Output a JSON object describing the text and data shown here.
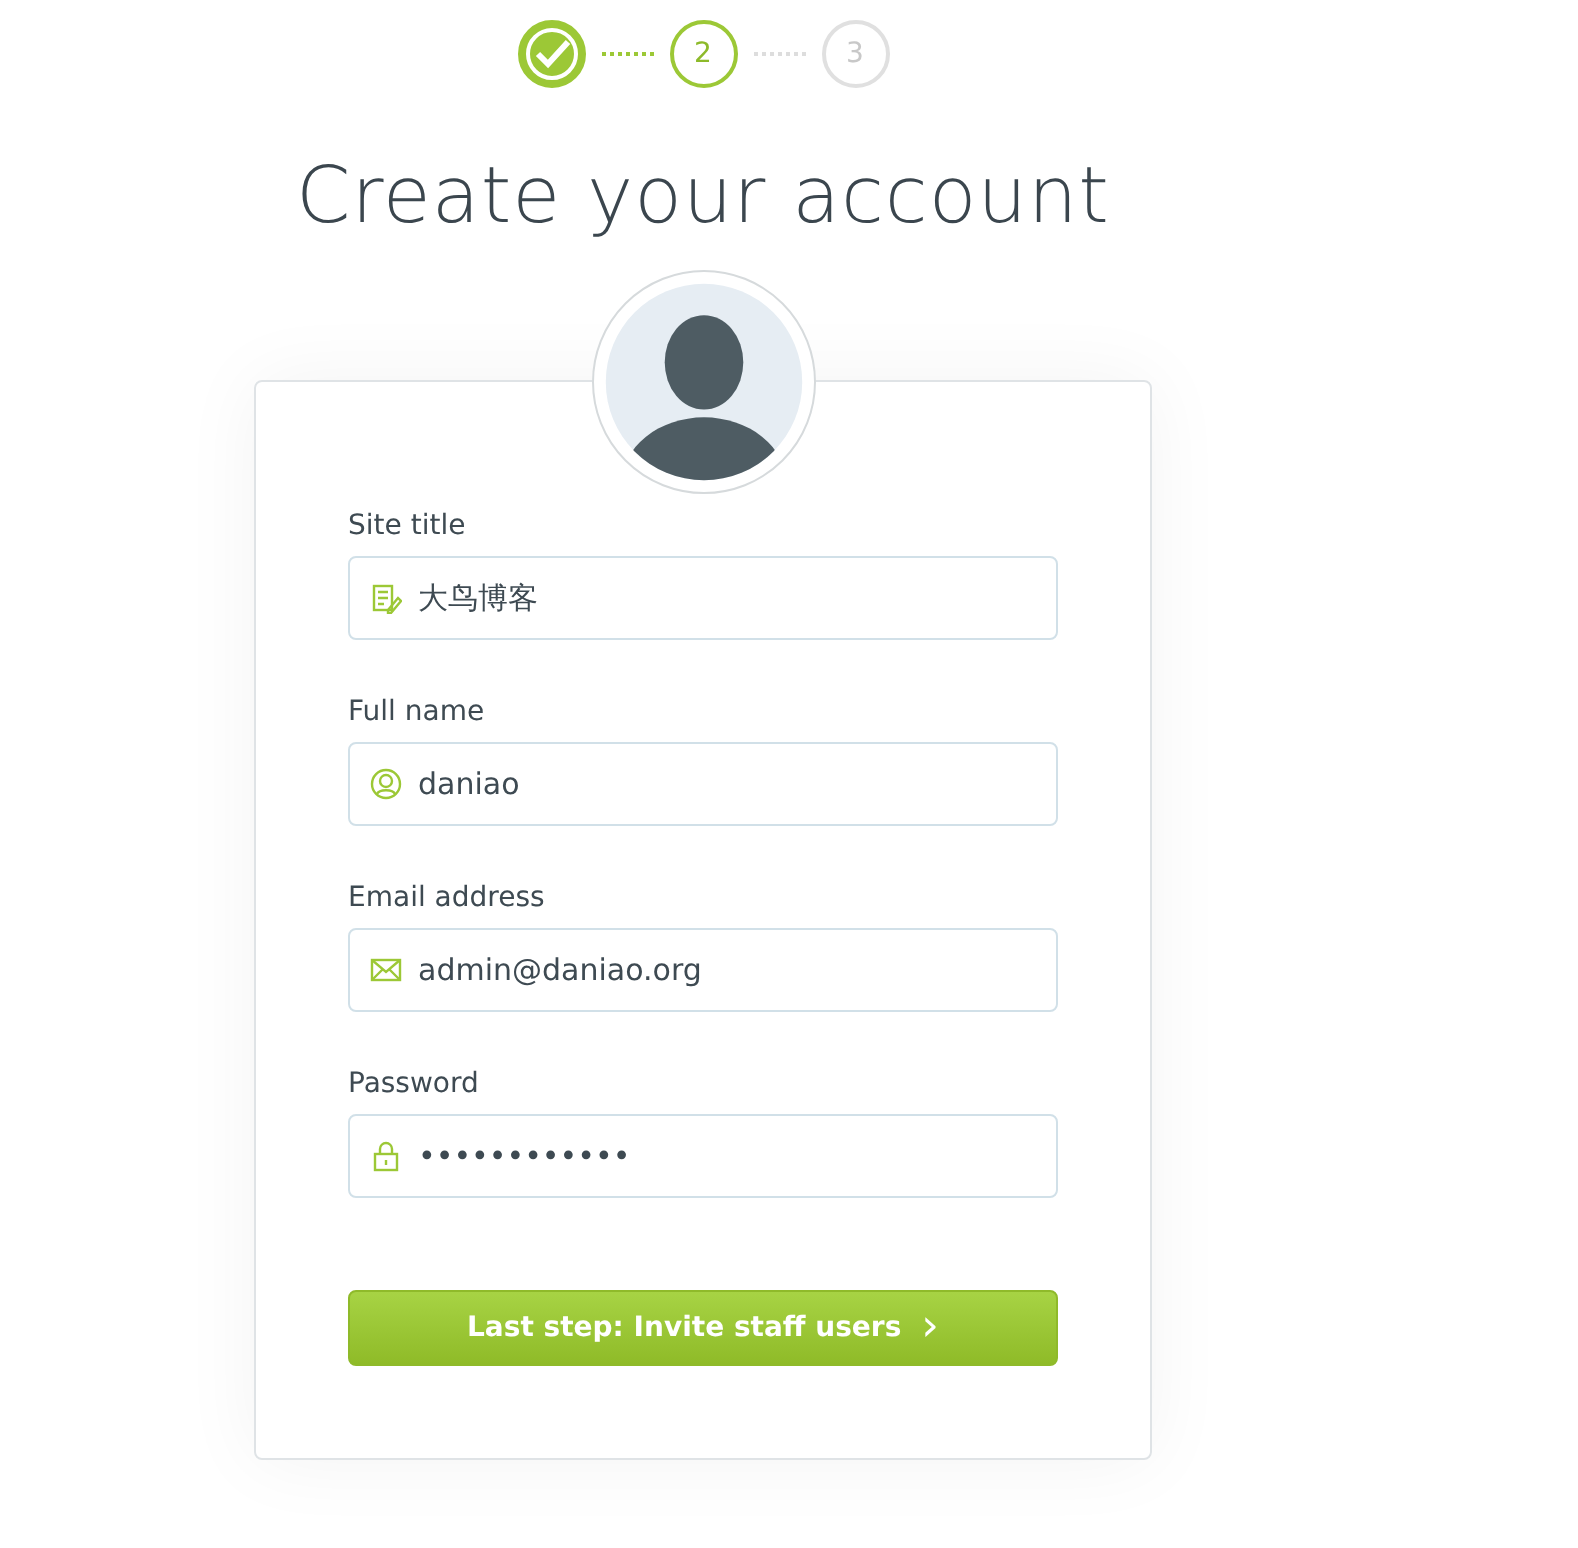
{
  "steps": [
    {
      "completed": true,
      "selected": false
    },
    {
      "completed": false,
      "selected": true,
      "label": "2"
    },
    {
      "completed": false,
      "selected": false,
      "label": "3"
    }
  ],
  "title": "Create your account",
  "fields": [
    {
      "kind": "site",
      "label": "Site title",
      "value": "大鸟博客"
    },
    {
      "kind": "person",
      "label": "Full name",
      "value": "daniao"
    },
    {
      "kind": "email",
      "label": "Email address",
      "value": "admin@daniao.org"
    },
    {
      "kind": "lock",
      "label": "Password",
      "value": "••••••••••••"
    }
  ],
  "submit": {
    "label": "Last step: Invite staff users",
    "arrow": "›"
  }
}
